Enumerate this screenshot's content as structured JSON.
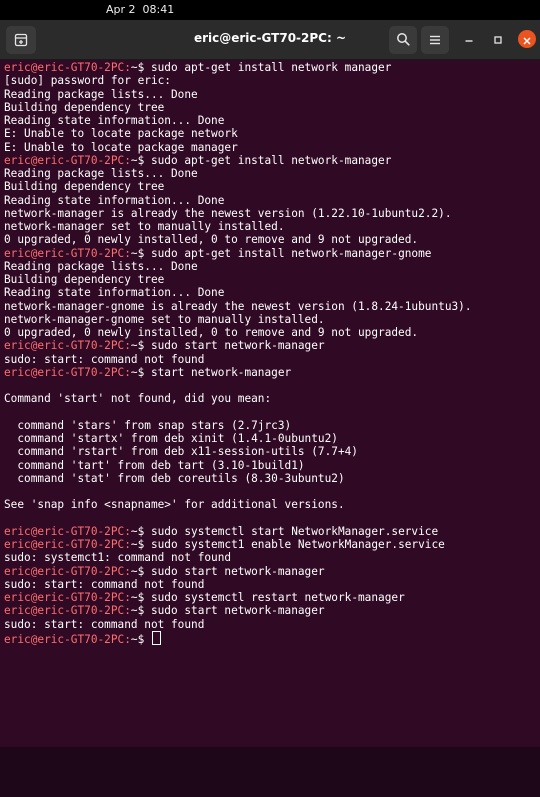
{
  "topbar": {
    "clock": "Apr 2  08:41"
  },
  "titlebar": {
    "title": "eric@eric-GT70-2PC: ~"
  },
  "icons": {
    "new_tab": "new-tab-icon",
    "search": "search-icon",
    "menu": "hamburger-menu-icon",
    "minimize": "minimize-icon",
    "maximize": "maximize-icon",
    "close": "close-icon"
  },
  "colors": {
    "terminal_bg": "#300a24",
    "prompt_fg": "#ff6e6e",
    "text_fg": "#ffffff",
    "titlebar_bg": "#2b2b2b",
    "close_button": "#e95420"
  },
  "terminal": {
    "lines": [
      {
        "prompt": "eric@eric-GT70-2PC:",
        "tail": "~$ sudo apt-get install network manager"
      },
      {
        "text": "[sudo] password for eric:"
      },
      {
        "text": "Reading package lists... Done"
      },
      {
        "text": "Building dependency tree"
      },
      {
        "text": "Reading state information... Done"
      },
      {
        "text": "E: Unable to locate package network"
      },
      {
        "text": "E: Unable to locate package manager"
      },
      {
        "prompt": "eric@eric-GT70-2PC:",
        "tail": "~$ sudo apt-get install network-manager"
      },
      {
        "text": "Reading package lists... Done"
      },
      {
        "text": "Building dependency tree"
      },
      {
        "text": "Reading state information... Done"
      },
      {
        "text": "network-manager is already the newest version (1.22.10-1ubuntu2.2)."
      },
      {
        "text": "network-manager set to manually installed."
      },
      {
        "text": "0 upgraded, 0 newly installed, 0 to remove and 9 not upgraded."
      },
      {
        "prompt": "eric@eric-GT70-2PC:",
        "tail": "~$ sudo apt-get install network-manager-gnome"
      },
      {
        "text": "Reading package lists... Done"
      },
      {
        "text": "Building dependency tree"
      },
      {
        "text": "Reading state information... Done"
      },
      {
        "text": "network-manager-gnome is already the newest version (1.8.24-1ubuntu3)."
      },
      {
        "text": "network-manager-gnome set to manually installed."
      },
      {
        "text": "0 upgraded, 0 newly installed, 0 to remove and 9 not upgraded."
      },
      {
        "prompt": "eric@eric-GT70-2PC:",
        "tail": "~$ sudo start network-manager"
      },
      {
        "text": "sudo: start: command not found"
      },
      {
        "prompt": "eric@eric-GT70-2PC:",
        "tail": "~$ start network-manager"
      },
      {
        "text": ""
      },
      {
        "text": "Command 'start' not found, did you mean:"
      },
      {
        "text": ""
      },
      {
        "text": "  command 'stars' from snap stars (2.7jrc3)"
      },
      {
        "text": "  command 'startx' from deb xinit (1.4.1-0ubuntu2)"
      },
      {
        "text": "  command 'rstart' from deb x11-session-utils (7.7+4)"
      },
      {
        "text": "  command 'tart' from deb tart (3.10-1build1)"
      },
      {
        "text": "  command 'stat' from deb coreutils (8.30-3ubuntu2)"
      },
      {
        "text": ""
      },
      {
        "text": "See 'snap info <snapname>' for additional versions."
      },
      {
        "text": ""
      },
      {
        "prompt": "eric@eric-GT70-2PC:",
        "tail": "~$ sudo systemctl start NetworkManager.service"
      },
      {
        "prompt": "eric@eric-GT70-2PC:",
        "tail": "~$ sudo systemct1 enable NetworkManager.service"
      },
      {
        "text": "sudo: systemct1: command not found"
      },
      {
        "prompt": "eric@eric-GT70-2PC:",
        "tail": "~$ sudo start network-manager"
      },
      {
        "text": "sudo: start: command not found"
      },
      {
        "prompt": "eric@eric-GT70-2PC:",
        "tail": "~$ sudo systemctl restart network-manager"
      },
      {
        "prompt": "eric@eric-GT70-2PC:",
        "tail": "~$ sudo start network-manager"
      },
      {
        "text": "sudo: start: command not found"
      },
      {
        "prompt": "eric@eric-GT70-2PC:",
        "tail": "~$ ",
        "cursor": true
      }
    ]
  }
}
